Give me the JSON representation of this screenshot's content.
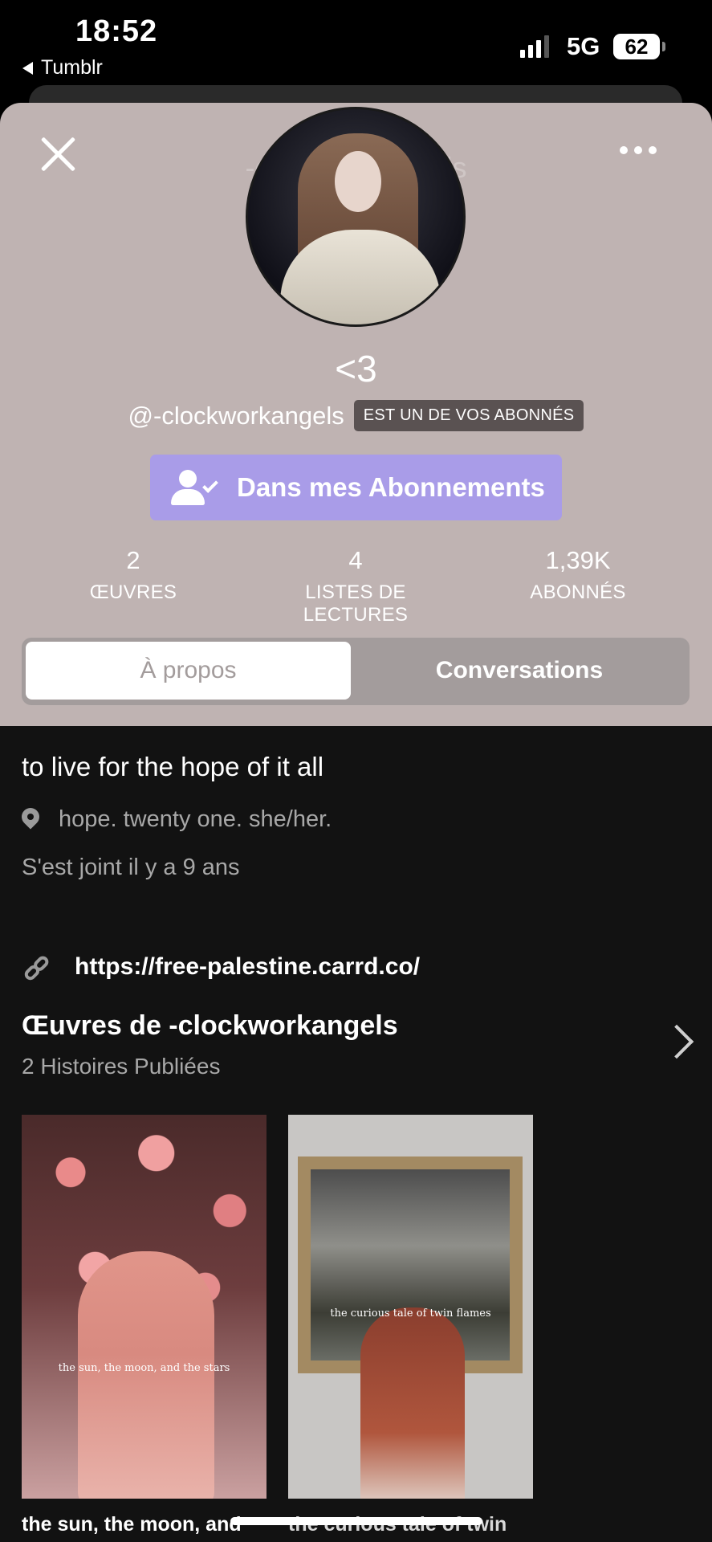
{
  "status_bar": {
    "time": "18:52",
    "back_app": "Tumblr",
    "network": "5G",
    "battery": "62"
  },
  "header": {
    "ghost_title": "-clockworkangels",
    "display_name": "<3",
    "handle": "@-clockworkangels",
    "follows_you_badge": "EST UN DE VOS ABONNÉS",
    "follow_button_label": "Dans mes Abonnements",
    "accent_color": "#a99ce8",
    "background_color": "#bfb3b2"
  },
  "stats": [
    {
      "value": "2",
      "label": "ŒUVRES"
    },
    {
      "value": "4",
      "label": "LISTES DE LECTURES"
    },
    {
      "value": "1,39K",
      "label": "ABONNÉS"
    }
  ],
  "tabs": [
    {
      "label": "À propos",
      "active": true
    },
    {
      "label": "Conversations",
      "active": false
    }
  ],
  "about": {
    "tagline": "to live for the hope of it all",
    "location": "hope. twenty one. she/her.",
    "joined": "S'est joint il y a 9 ans",
    "link": "https://free-palestine.carrd.co/"
  },
  "works": {
    "title": "Œuvres de -clockworkangels",
    "subtitle": "2 Histoires Publiées",
    "items": [
      {
        "cover_text": "the sun, the moon, and the stars",
        "title": "the sun, the moon, and"
      },
      {
        "cover_text": "the curious tale of twin flames",
        "title": "the curious tale of twin"
      }
    ]
  },
  "icons": {
    "close": "close-icon",
    "more": "more-icon",
    "follow": "user-check-icon",
    "location": "location-pin-icon",
    "link": "link-icon",
    "chevron": "chevron-right-icon"
  }
}
